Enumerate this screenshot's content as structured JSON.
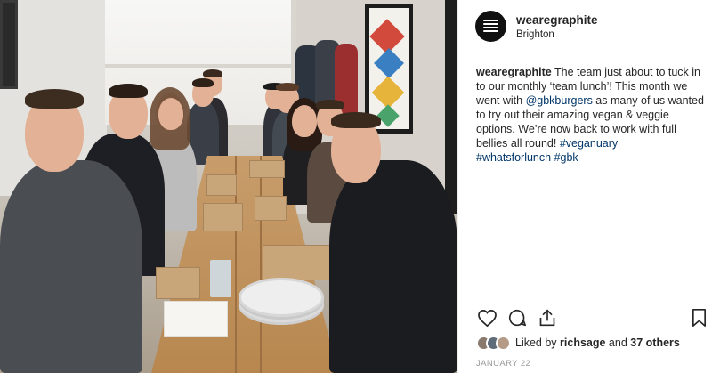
{
  "post": {
    "username": "wearegraphite",
    "location": "Brighton",
    "caption": {
      "author": "wearegraphite",
      "text_1": " The team just about to tuck in to our monthly ‘team lunch’! This month we went with ",
      "mention": "@gbkburgers",
      "text_2": " as many of us wanted to try out their amazing vegan & veggie options. We’re now back to work with full bellies all round! ",
      "hashtags": [
        "#veganuary",
        "#whatsforlunch",
        "#gbk"
      ]
    },
    "actions": {
      "like_icon": "heart-icon",
      "comment_icon": "comment-icon",
      "share_icon": "share-icon",
      "save_icon": "bookmark-icon"
    },
    "likes": {
      "prefix": "Liked by ",
      "user": "richsage",
      "connector": " and ",
      "others": "37 others"
    },
    "date": "JANUARY 22"
  },
  "colors": {
    "link": "#003569",
    "text": "#262626",
    "muted": "#999999",
    "avatar": "#111111"
  }
}
